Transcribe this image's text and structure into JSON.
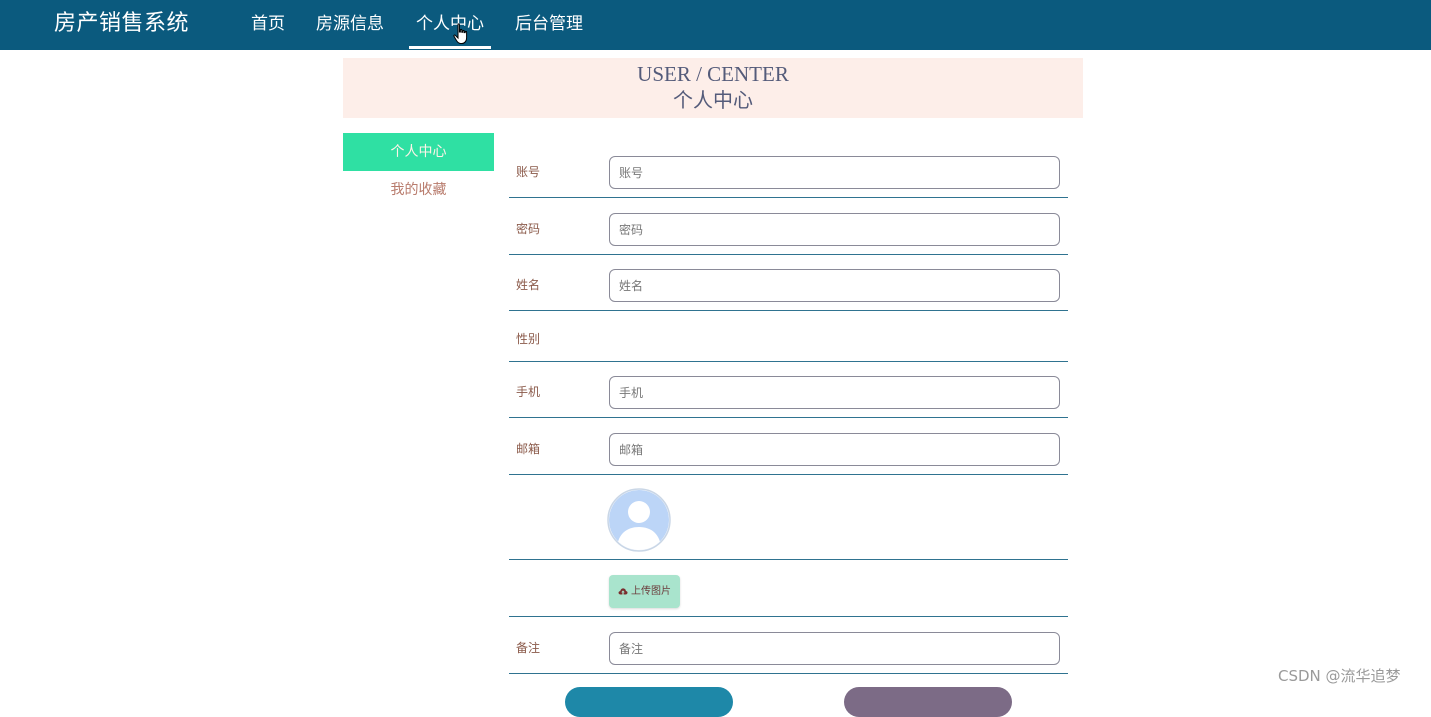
{
  "header": {
    "brand": "房产销售系统",
    "nav": [
      {
        "label": "首页"
      },
      {
        "label": "房源信息"
      },
      {
        "label": "个人中心"
      },
      {
        "label": "后台管理"
      }
    ],
    "active_nav": "个人中心"
  },
  "banner": {
    "title_en": "USER / CENTER",
    "title_cn": "个人中心"
  },
  "sidebar": {
    "items": [
      {
        "label": "个人中心",
        "active": true
      },
      {
        "label": "我的收藏",
        "active": false
      }
    ]
  },
  "form": {
    "fields": [
      {
        "label": "账号",
        "placeholder": "账号",
        "value": ""
      },
      {
        "label": "密码",
        "placeholder": "密码",
        "value": ""
      },
      {
        "label": "姓名",
        "placeholder": "姓名",
        "value": ""
      },
      {
        "label": "性别"
      },
      {
        "label": "手机",
        "placeholder": "手机",
        "value": ""
      },
      {
        "label": "邮箱",
        "placeholder": "邮箱",
        "value": ""
      },
      {
        "label": "备注",
        "placeholder": "备注",
        "value": ""
      }
    ],
    "upload_label": "上传图片"
  },
  "watermark": "CSDN @流华追梦",
  "colors": {
    "topbar": "#0b5a7e",
    "banner_bg": "#fdeee9",
    "sidebar_active": "#2fe0a3",
    "row_line": "#2f7390",
    "upload_btn": "#a9e4cd",
    "btn_left": "#1e88a8",
    "btn_right": "#7c6b86"
  },
  "icons": {
    "cursor": "hand-pointer-icon",
    "upload": "cloud-upload-icon",
    "avatar": "user-avatar-icon"
  }
}
